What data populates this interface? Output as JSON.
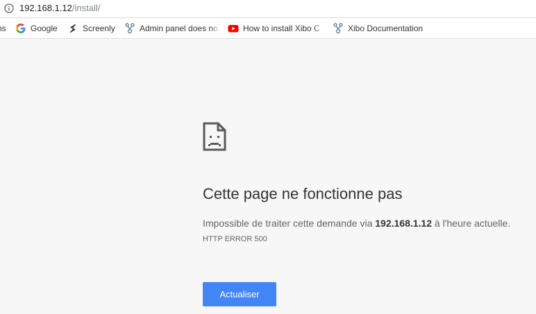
{
  "address_bar": {
    "host": "192.168.1.12",
    "path": "/install/"
  },
  "bookmarks": [
    {
      "label": "ns",
      "icon": "apps-icon"
    },
    {
      "label": "Google",
      "icon": "google-icon"
    },
    {
      "label": "Screenly",
      "icon": "screenly-icon"
    },
    {
      "label": "Admin panel does no",
      "icon": "xibo-icon"
    },
    {
      "label": "How to install Xibo C",
      "icon": "youtube-icon"
    },
    {
      "label": "Xibo Documentation",
      "icon": "xibo-icon"
    }
  ],
  "error": {
    "title": "Cette page ne fonctionne pas",
    "desc_before": "Impossible de traiter cette demande via ",
    "desc_host": "192.168.1.12",
    "desc_after": " à l'heure actuelle.",
    "code": "HTTP ERROR 500",
    "reload_label": "Actualiser"
  },
  "colors": {
    "reload_button": "#4285f4",
    "background": "#f7f7f7"
  }
}
